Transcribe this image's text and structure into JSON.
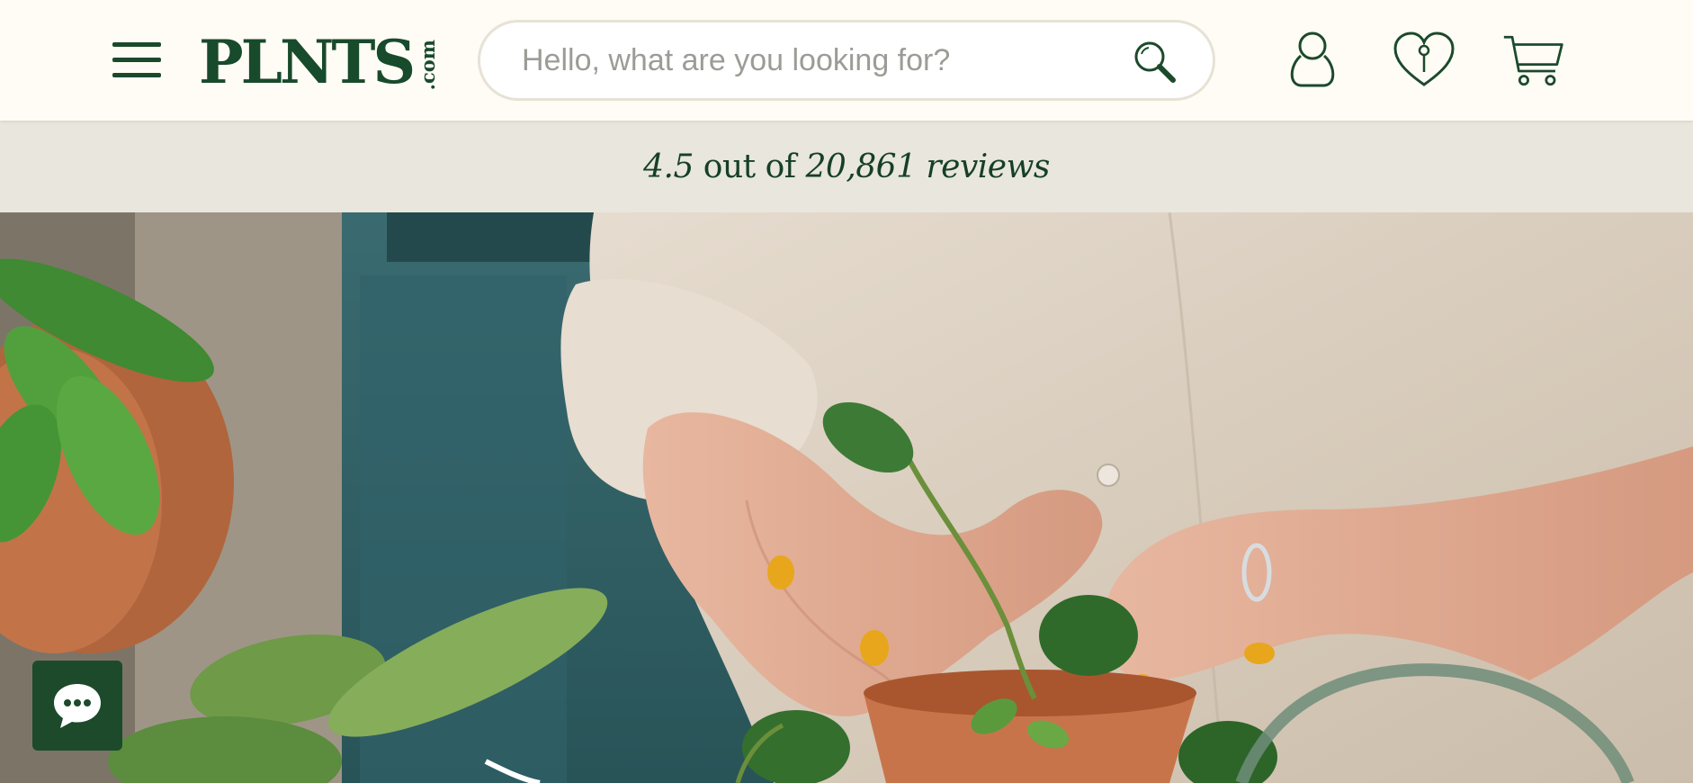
{
  "header": {
    "logo_main": "PLNTS",
    "logo_suffix": ".com",
    "search_placeholder": "Hello, what are you looking for?",
    "icons": [
      "menu-icon",
      "search-icon",
      "user-icon",
      "heart-icon",
      "cart-icon"
    ]
  },
  "reviews": {
    "rating": "4.5",
    "middle": " out of ",
    "count": "20,861 reviews"
  },
  "hero": {
    "image": "hands-potting-plant-photo"
  },
  "chat": {
    "icon": "chat-bubble-icon"
  },
  "colors": {
    "brand_green": "#1b4a2b",
    "header_bg": "#fffcf5",
    "reviews_bg": "#e8e6dd"
  }
}
